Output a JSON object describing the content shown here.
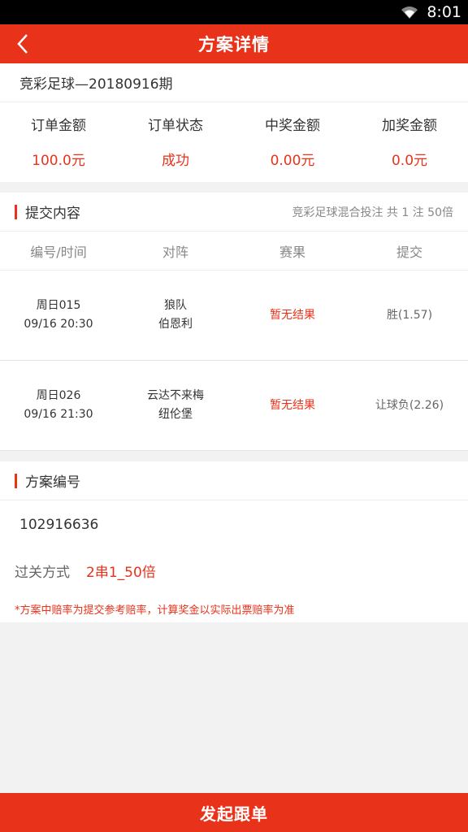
{
  "status_bar": {
    "time": "8:01"
  },
  "app_bar": {
    "title": "方案详情"
  },
  "issue": {
    "title": "竞彩足球—20180916期"
  },
  "summary": [
    {
      "label": "订单金额",
      "value": "100.0元"
    },
    {
      "label": "订单状态",
      "value": "成功"
    },
    {
      "label": "中奖金额",
      "value": "0.00元"
    },
    {
      "label": "加奖金额",
      "value": "0.0元"
    }
  ],
  "submission": {
    "title": "提交内容",
    "meta": "竞彩足球混合投注 共 1 注 50倍",
    "columns": [
      "编号/时间",
      "对阵",
      "赛果",
      "提交"
    ],
    "rows": [
      {
        "code": "周日015",
        "time": "09/16 20:30",
        "home": "狼队",
        "away": "伯恩利",
        "result": "暂无结果",
        "pick": "胜(1.57)"
      },
      {
        "code": "周日026",
        "time": "09/16 21:30",
        "home": "云达不来梅",
        "away": "纽伦堡",
        "result": "暂无结果",
        "pick": "让球负(2.26)"
      }
    ]
  },
  "plan": {
    "title": "方案编号",
    "number": "102916636",
    "pass_label": "过关方式",
    "pass_value": "2串1_50倍",
    "note": "*方案中赔率为提交参考赔率，计算奖金以实际出票赔率为准"
  },
  "bottom_button": {
    "label": "发起跟单"
  },
  "colors": {
    "accent": "#e8321a",
    "background": "#f2f2f2"
  },
  "icons": {
    "back": "chevron-left-icon",
    "signal": "wifi-icon"
  }
}
